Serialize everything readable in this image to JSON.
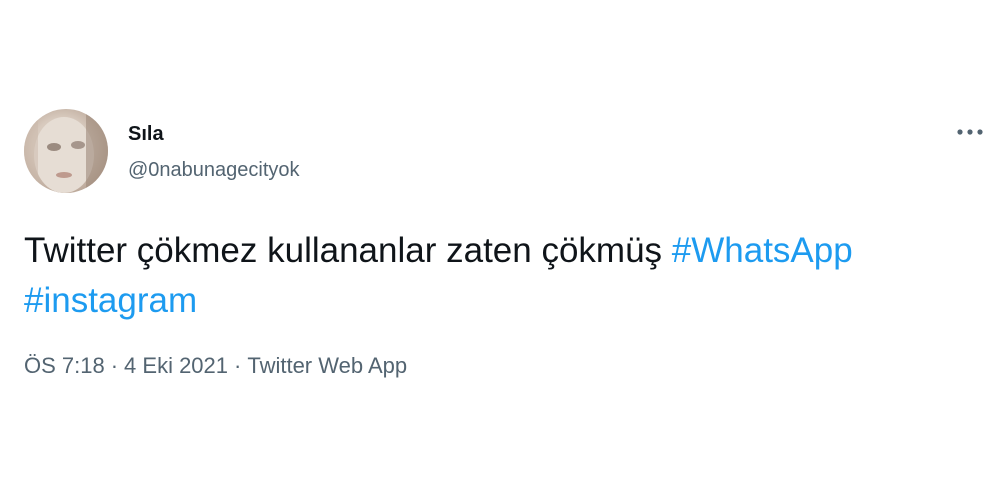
{
  "user": {
    "display_name": "Sıla",
    "handle": "@0nabunagecityok",
    "avatar_icon": "profile-photo"
  },
  "more_icon": "ellipsis-icon",
  "tweet": {
    "text_plain": "Twitter çökmez kullananlar zaten çökmüş ",
    "hashtags": [
      "#WhatsApp",
      "#instagram"
    ]
  },
  "meta": {
    "time": "ÖS 7:18",
    "separator": "·",
    "date": "4 Eki 2021",
    "source": "Twitter Web App"
  },
  "colors": {
    "text": "#0f1419",
    "secondary": "#536471",
    "link": "#1d9bf0"
  }
}
